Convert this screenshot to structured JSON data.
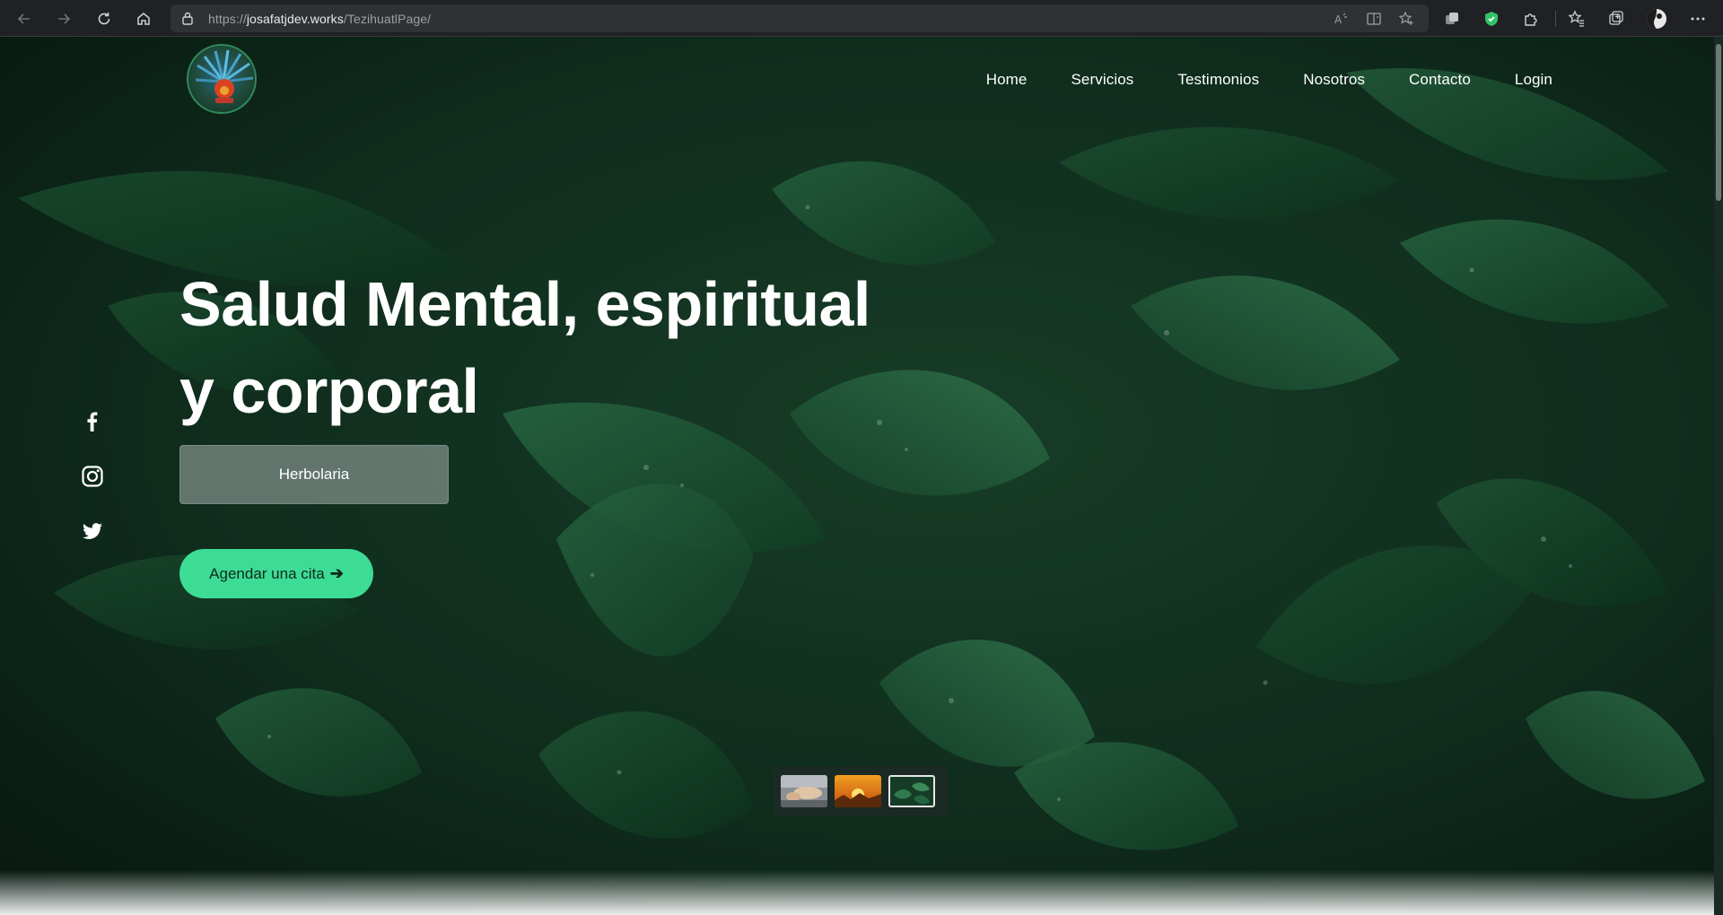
{
  "browser": {
    "url_prefix": "https://",
    "url_domain": "josafatjdev.works",
    "url_path": "/TezihuatlPage/",
    "icons": [
      "back-icon",
      "forward-icon",
      "refresh-icon",
      "home-icon",
      "lock-icon",
      "read-aloud-icon",
      "immersive-reader-icon",
      "add-favorite-icon",
      "extension-icon",
      "shield-extension-icon",
      "puzzle-icon",
      "favorites-icon",
      "collections-icon",
      "profile-icon",
      "more-icon"
    ]
  },
  "nav": {
    "items": [
      {
        "label": "Home"
      },
      {
        "label": "Servicios"
      },
      {
        "label": "Testimonios"
      },
      {
        "label": "Nosotros"
      },
      {
        "label": "Contacto"
      },
      {
        "label": "Login"
      }
    ]
  },
  "hero": {
    "title_line1": "Salud Mental, espiritual",
    "title_line2": "y corporal",
    "tag": "Herbolaria",
    "cta_label": "Agendar una cita",
    "cta_arrow": "➔"
  },
  "social": [
    "facebook-icon",
    "instagram-icon",
    "twitter-icon"
  ],
  "carousel": {
    "thumbnails": [
      "massage-thumbnail",
      "sunset-thumbnail",
      "leaves-thumbnail"
    ],
    "active_index": 2
  },
  "colors": {
    "accent": "#3ddc94",
    "chrome": "#202124"
  }
}
